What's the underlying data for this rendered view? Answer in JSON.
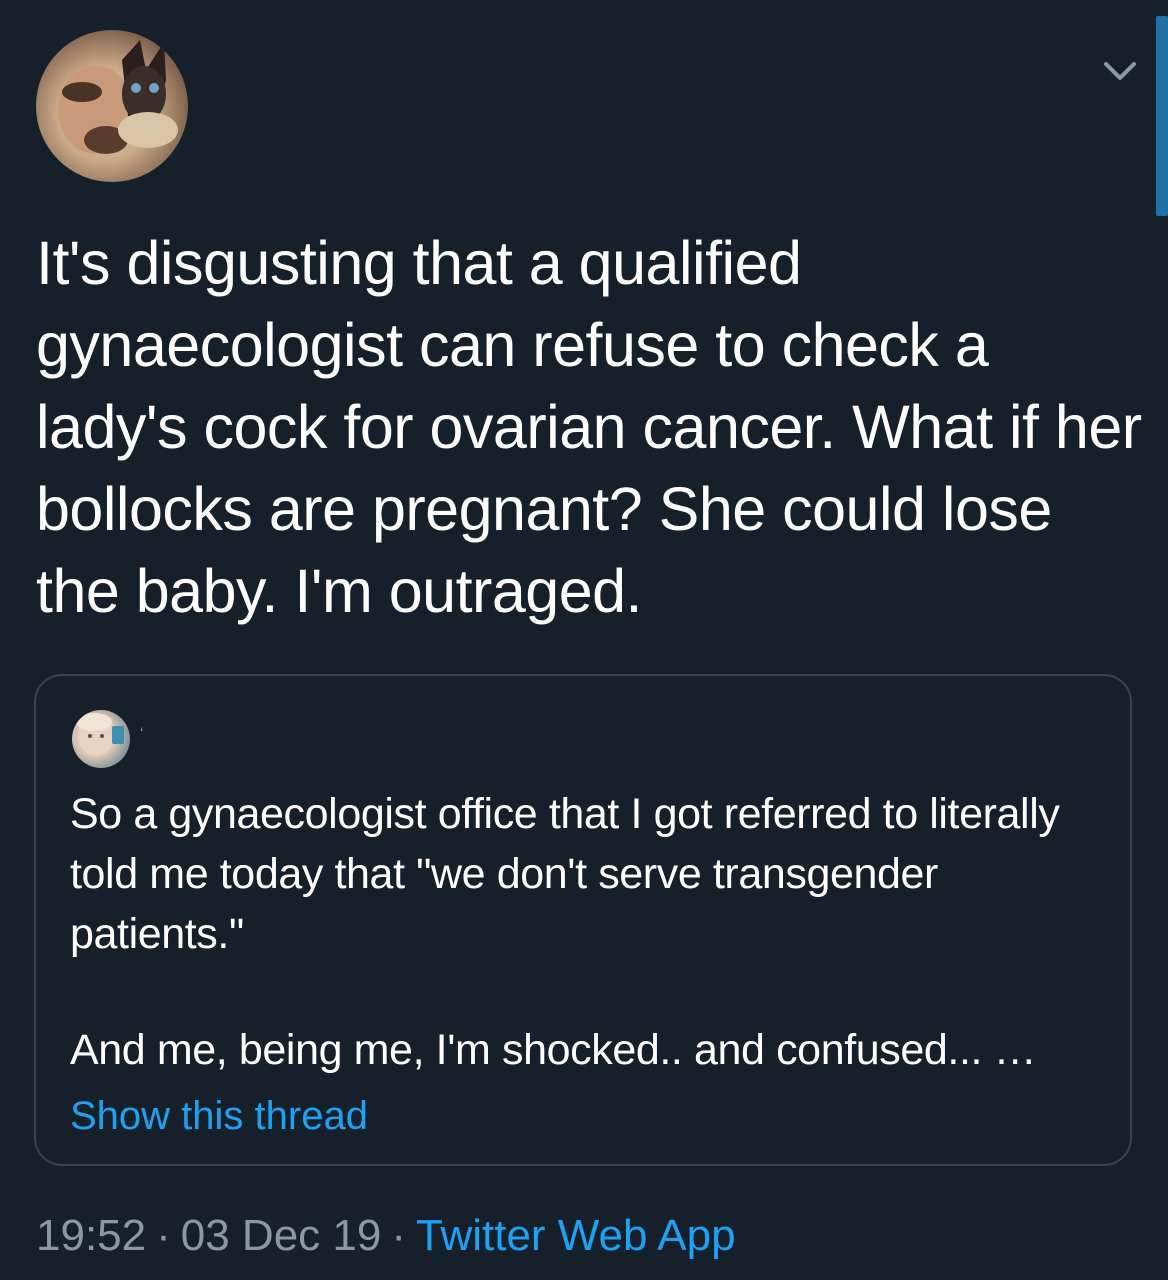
{
  "tweet": {
    "text": "It's disgusting that a qualified gynaecologist can refuse to check a lady's cock for ovarian cancer. What if her bollocks are pregnant? She could lose the baby. I'm outraged.",
    "time": "19:52",
    "date": "03 Dec 19",
    "separator": "·",
    "source": "Twitter Web App"
  },
  "quoted_tweet": {
    "name": "ʻ",
    "text": "So a gynaecologist office that I got referred to literally told me today that \"we don't serve transgender patients.\"",
    "text_continued": "And me, being me, I'm shocked.. and confused... …",
    "show_thread_label": "Show this thread"
  },
  "icons": {
    "caret": "chevron-down-icon",
    "avatar": "user-avatar",
    "quoted_avatar": "quoted-user-avatar"
  },
  "colors": {
    "background": "#15202b",
    "text": "#ffffff",
    "secondary": "#8899a6",
    "accent": "#1da1f2",
    "border": "#38444d"
  }
}
